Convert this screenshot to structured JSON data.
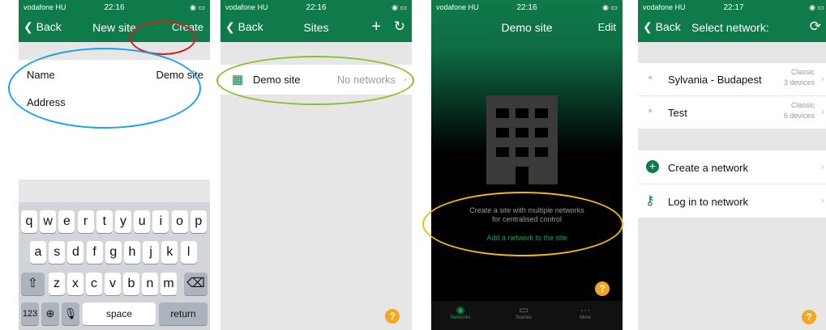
{
  "status": {
    "carrier": "vodafone HU",
    "time1": "22:16",
    "time2": "22:16",
    "time3": "22:16",
    "time4": "22:17"
  },
  "screen1": {
    "back_label": "Back",
    "title": "New site",
    "create_label": "Create",
    "name_label": "Name",
    "name_value": "Demo site",
    "address_label": "Address",
    "keyboard": {
      "row1": [
        "q",
        "w",
        "e",
        "r",
        "t",
        "y",
        "u",
        "i",
        "o",
        "p"
      ],
      "row2": [
        "a",
        "s",
        "d",
        "f",
        "g",
        "h",
        "j",
        "k",
        "l"
      ],
      "row3": [
        "z",
        "x",
        "c",
        "v",
        "b",
        "n",
        "m"
      ],
      "numbers": "123",
      "space": "space",
      "return": "return"
    }
  },
  "screen2": {
    "back_label": "Back",
    "title": "Sites",
    "site_name": "Demo site",
    "site_status": "No networks"
  },
  "screen3": {
    "title": "Demo site",
    "edit_label": "Edit",
    "message_line1": "Create a site with multiple networks",
    "message_line2": "for centralised control",
    "add_link": "Add a network to the site",
    "tabs": [
      "Networks",
      "Scenes",
      "More"
    ]
  },
  "screen4": {
    "back_label": "Back",
    "title": "Select network:",
    "networks": [
      {
        "name": "Sylvania - Budapest",
        "type": "Classic",
        "devices": "3 devices"
      },
      {
        "name": "Test",
        "type": "Classic",
        "devices": "6 devices"
      }
    ],
    "actions": [
      "Create a network",
      "Log in to network"
    ]
  },
  "help_label": "?",
  "colors": {
    "nav_green": "#0f7a4a",
    "accent_green": "#14a05a",
    "highlight_red": "#d11f1f",
    "highlight_blue": "#1aa3e8",
    "highlight_lime": "#8cbf2b",
    "highlight_orange": "#f5b914"
  }
}
